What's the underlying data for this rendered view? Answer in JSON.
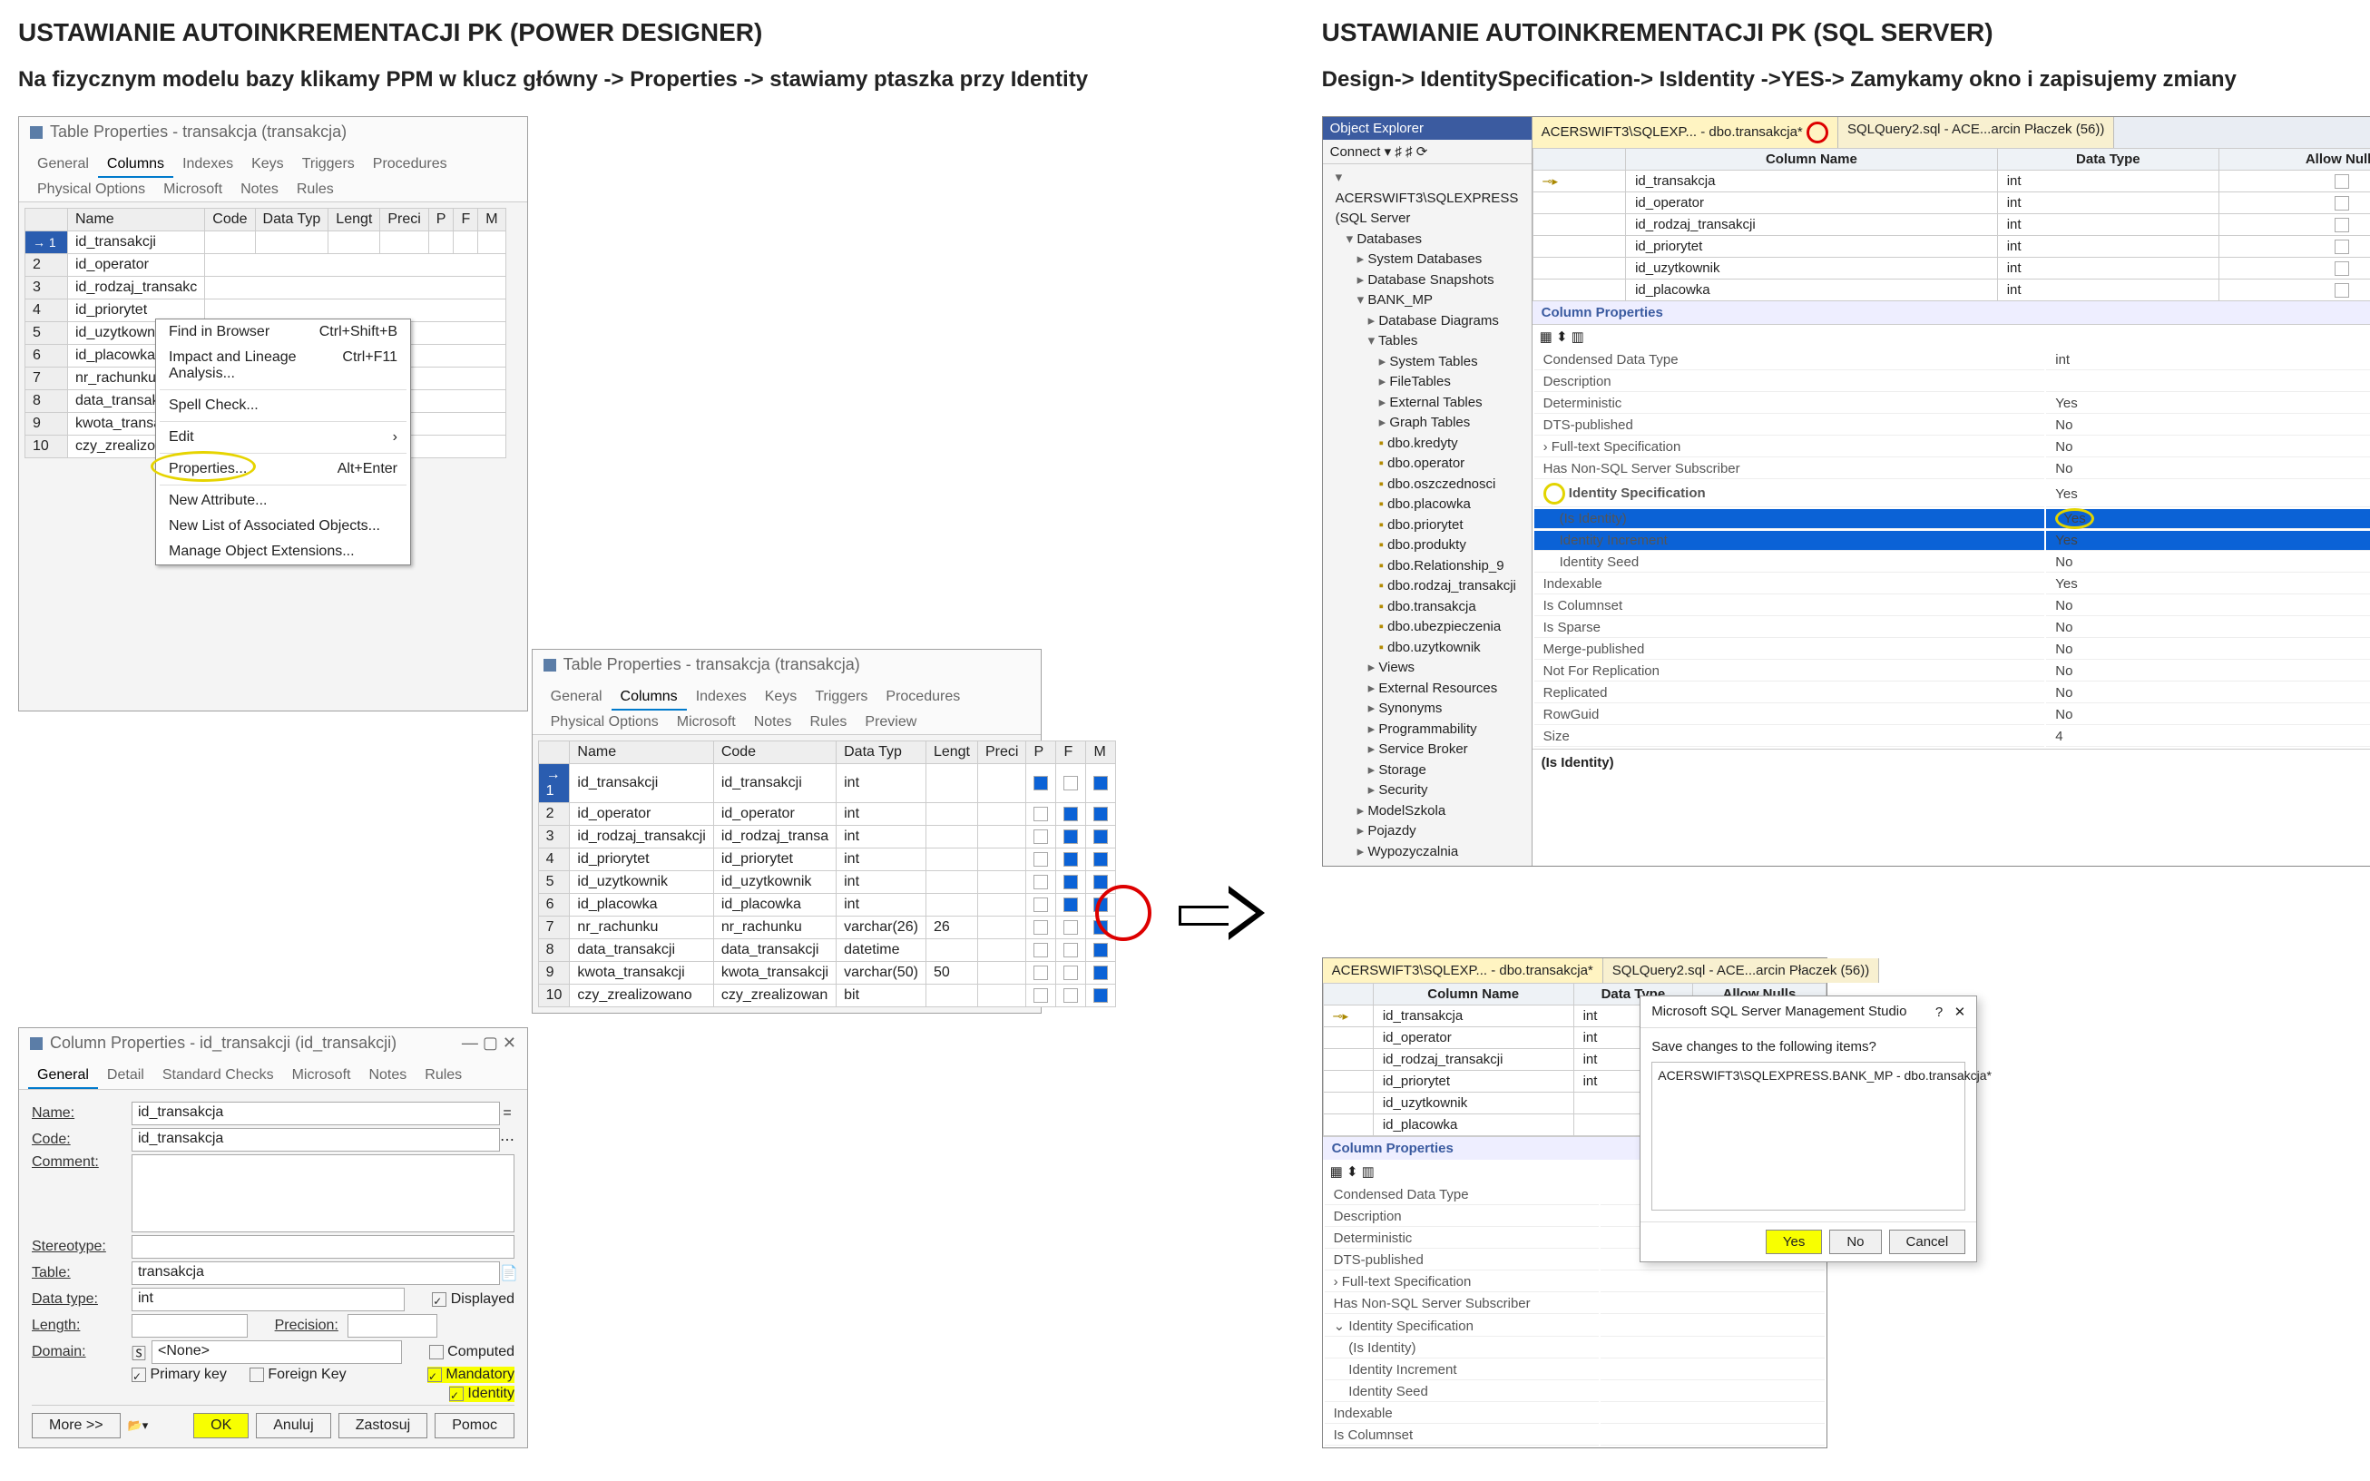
{
  "left": {
    "title": "USTAWIANIE AUTOINKREMENTACJI PK (POWER DESIGNER)",
    "subtitle": "Na fizycznym modelu bazy klikamy PPM w klucz główny -> Properties -> stawiamy ptaszka przy Identity",
    "win1": {
      "title": "Table Properties - transakcja (transakcja)",
      "tabs": [
        "General",
        "Columns",
        "Indexes",
        "Keys",
        "Triggers",
        "Procedures",
        "Physical Options",
        "Microsoft",
        "Notes",
        "Rules"
      ],
      "active_tab": "Columns",
      "headers": [
        "",
        "Name",
        "Code",
        "Data Typ",
        "Lengt",
        "Preci",
        "P",
        "F",
        "M"
      ],
      "rows": [
        [
          "1",
          "id_transakcji"
        ],
        [
          "2",
          "id_operator"
        ],
        [
          "3",
          "id_rodzaj_transakc"
        ],
        [
          "4",
          "id_priorytet"
        ],
        [
          "5",
          "id_uzytkownik"
        ],
        [
          "6",
          "id_placowka"
        ],
        [
          "7",
          "nr_rachunku"
        ],
        [
          "8",
          "data_transakcji"
        ],
        [
          "9",
          "kwota_transakcji"
        ],
        [
          "10",
          "czy_zrealizowano"
        ]
      ],
      "context_menu": [
        {
          "label": "Find in Browser",
          "accel": "Ctrl+Shift+B"
        },
        {
          "label": "Impact and Lineage Analysis...",
          "accel": "Ctrl+F11"
        },
        {
          "sep": true
        },
        {
          "label": "Spell Check..."
        },
        {
          "sep": true
        },
        {
          "label": "Edit",
          "accel": "›"
        },
        {
          "sep": true
        },
        {
          "label": "Properties...",
          "accel": "Alt+Enter",
          "hl": true
        },
        {
          "sep": true
        },
        {
          "label": "New Attribute..."
        },
        {
          "label": "New List of Associated Objects..."
        },
        {
          "label": "Manage Object Extensions..."
        }
      ]
    },
    "win2": {
      "title": "Table Properties - transakcja (transakcja)",
      "tabs": [
        "General",
        "Columns",
        "Indexes",
        "Keys",
        "Triggers",
        "Procedures",
        "Physical Options",
        "Microsoft",
        "Notes",
        "Rules",
        "Preview"
      ],
      "active_tab": "Columns",
      "headers": [
        "",
        "Name",
        "Code",
        "Data Typ",
        "Lengt",
        "Preci",
        "P",
        "F",
        "M"
      ],
      "rows": [
        [
          "1",
          "id_transakcji",
          "id_transakcji",
          "int",
          "",
          "",
          "1",
          "",
          "1"
        ],
        [
          "2",
          "id_operator",
          "id_operator",
          "int",
          "",
          "",
          "",
          "1",
          "1"
        ],
        [
          "3",
          "id_rodzaj_transakcji",
          "id_rodzaj_transa",
          "int",
          "",
          "",
          "",
          "1",
          "1"
        ],
        [
          "4",
          "id_priorytet",
          "id_priorytet",
          "int",
          "",
          "",
          "",
          "1",
          "1"
        ],
        [
          "5",
          "id_uzytkownik",
          "id_uzytkownik",
          "int",
          "",
          "",
          "",
          "1",
          "1"
        ],
        [
          "6",
          "id_placowka",
          "id_placowka",
          "int",
          "",
          "",
          "",
          "1",
          "1"
        ],
        [
          "7",
          "nr_rachunku",
          "nr_rachunku",
          "varchar(26)",
          "26",
          "",
          "",
          "",
          "1"
        ],
        [
          "8",
          "data_transakcji",
          "data_transakcji",
          "datetime",
          "",
          "",
          "",
          "",
          "1"
        ],
        [
          "9",
          "kwota_transakcji",
          "kwota_transakcji",
          "varchar(50)",
          "50",
          "",
          "",
          "",
          "1"
        ],
        [
          "10",
          "czy_zrealizowano",
          "czy_zrealizowan",
          "bit",
          "",
          "",
          "",
          "",
          "1"
        ]
      ]
    },
    "colprops": {
      "title": "Column Properties - id_transakcji (id_transakcji)",
      "tabs": [
        "General",
        "Detail",
        "Standard Checks",
        "Microsoft",
        "Notes",
        "Rules"
      ],
      "active_tab": "General",
      "fields": {
        "name_lbl": "Name:",
        "name": "id_transakcja",
        "code_lbl": "Code:",
        "code": "id_transakcja",
        "comment_lbl": "Comment:",
        "comment": "",
        "stereo_lbl": "Stereotype:",
        "stereo": "",
        "table_lbl": "Table:",
        "table": "transakcja",
        "dtype_lbl": "Data type:",
        "dtype": "int",
        "displayed": "Displayed",
        "length_lbl": "Length:",
        "prec_lbl": "Precision:",
        "domain_lbl": "Domain:",
        "domain": "<None>",
        "computed": "Computed",
        "pk": "Primary key",
        "fk": "Foreign Key",
        "mandatory": "Mandatory",
        "identity": "Identity"
      },
      "buttons": {
        "more": "More >>",
        "ok": "OK",
        "cancel": "Anuluj",
        "apply": "Zastosuj",
        "help": "Pomoc"
      }
    }
  },
  "right": {
    "title": "USTAWIANIE AUTOINKREMENTACJI PK (SQL SERVER)",
    "subtitle": "Design-> IdentitySpecification-> IsIdentity ->YES-> Zamykamy okno i zapisujemy zmiany",
    "objexp_title": "Object Explorer",
    "connect": "Connect ▾",
    "tree": {
      "server": "ACERSWIFT3\\SQLEXPRESS (SQL Server",
      "databases": "Databases",
      "sysdb": "System Databases",
      "dbsnap": "Database Snapshots",
      "bank": "BANK_MP",
      "ddiag": "Database Diagrams",
      "tables": "Tables",
      "systables": "System Tables",
      "filetables": "FileTables",
      "exttables": "External Tables",
      "graphtables": "Graph Tables",
      "t": [
        "dbo.kredyty",
        "dbo.operator",
        "dbo.oszczednosci",
        "dbo.placowka",
        "dbo.priorytet",
        "dbo.produkty",
        "dbo.Relationship_9",
        "dbo.rodzaj_transakcji",
        "dbo.transakcja",
        "dbo.ubezpieczenia",
        "dbo.uzytkownik"
      ],
      "views": "Views",
      "extres": "External Resources",
      "syn": "Synonyms",
      "prog": "Programmability",
      "sb": "Service Broker",
      "storage": "Storage",
      "sec": "Security",
      "ms": "ModelSzkola",
      "poj": "Pojazdy",
      "wyp": "Wypozyczalnia"
    },
    "doc_tabs": [
      "ACERSWIFT3\\SQLEXP... - dbo.transakcja*",
      "SQLQuery2.sql - ACE...arcin Płaczek (56))"
    ],
    "col_headers": [
      "Column Name",
      "Data Type",
      "Allow Nulls"
    ],
    "cols": [
      [
        "id_transakcja",
        "int",
        ""
      ],
      [
        "id_operator",
        "int",
        ""
      ],
      [
        "id_rodzaj_transakcji",
        "int",
        ""
      ],
      [
        "id_priorytet",
        "int",
        ""
      ],
      [
        "id_uzytkownik",
        "int",
        ""
      ],
      [
        "id_placowka",
        "int",
        ""
      ]
    ],
    "col_props_title": "Column Properties",
    "props": [
      [
        "Condensed Data Type",
        "int"
      ],
      [
        "Description",
        ""
      ],
      [
        "Deterministic",
        "Yes"
      ],
      [
        "DTS-published",
        "No"
      ],
      [
        "Full-text Specification",
        "No"
      ],
      [
        "Has Non-SQL Server Subscriber",
        "No"
      ],
      [
        "Identity Specification",
        "Yes"
      ],
      [
        "(Is Identity)",
        "Yes"
      ],
      [
        "Identity Increment",
        "Yes"
      ],
      [
        "Identity Seed",
        "No"
      ],
      [
        "Indexable",
        "Yes"
      ],
      [
        "Is Columnset",
        "No"
      ],
      [
        "Is Sparse",
        "No"
      ],
      [
        "Merge-published",
        "No"
      ],
      [
        "Not For Replication",
        "No"
      ],
      [
        "Replicated",
        "No"
      ],
      [
        "RowGuid",
        "No"
      ],
      [
        "Size",
        "4"
      ]
    ],
    "footer": "(Is Identity)",
    "ssms2": {
      "doc_tabs": [
        "ACERSWIFT3\\SQLEXP... - dbo.transakcja*",
        "SQLQuery2.sql - ACE...arcin Płaczek (56))"
      ],
      "cols": [
        [
          "id_transakcja",
          "int",
          ""
        ],
        [
          "id_operator",
          "int",
          ""
        ],
        [
          "id_rodzaj_transakcji",
          "int",
          ""
        ],
        [
          "id_priorytet",
          "int",
          ""
        ],
        [
          "id_uzytkownik",
          "",
          " "
        ],
        [
          "id_placowka",
          "",
          " "
        ]
      ],
      "props": [
        [
          "Condensed Data Type",
          ""
        ],
        [
          "Description",
          ""
        ],
        [
          "Deterministic",
          ""
        ],
        [
          "DTS-published",
          ""
        ],
        [
          "Full-text Specification",
          ""
        ],
        [
          "Has Non-SQL Server Subscriber",
          ""
        ],
        [
          "Identity Specification",
          ""
        ],
        [
          "(Is Identity)",
          ""
        ],
        [
          "Identity Increment",
          ""
        ],
        [
          "Identity Seed",
          ""
        ],
        [
          "Indexable",
          ""
        ],
        [
          "Is Columnset",
          ""
        ]
      ]
    },
    "dialog": {
      "title": "Microsoft SQL Server Management Studio",
      "question": "Save changes to the following items?",
      "item": "ACERSWIFT3\\SQLEXPRESS.BANK_MP - dbo.transakcja*",
      "yes": "Yes",
      "no": "No",
      "cancel": "Cancel"
    }
  }
}
